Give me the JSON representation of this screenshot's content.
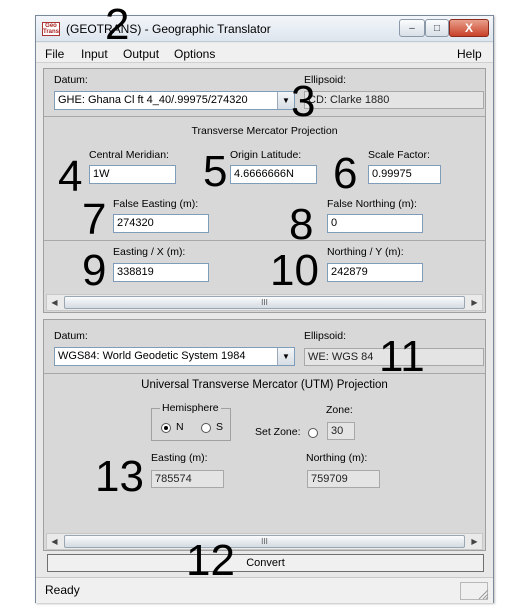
{
  "window": {
    "icon_text": "Geo Trans",
    "title": "(GEOTRANS) - Geographic Translator",
    "controls": {
      "minimize": "–",
      "maximize": "□",
      "close": "X"
    }
  },
  "menu": {
    "file": "File",
    "input": "Input",
    "output": "Output",
    "options": "Options",
    "help": "Help"
  },
  "input_panel": {
    "datum_label": "Datum:",
    "datum_value": "GHE:  Ghana Cl ft 4_40/.99975/274320",
    "ellipsoid_label": "Ellipsoid:",
    "ellipsoid_value": "CD: Clarke 1880",
    "projection_title": "Transverse Mercator Projection",
    "central_meridian_label": "Central Meridian:",
    "central_meridian_value": "1W",
    "origin_latitude_label": "Origin Latitude:",
    "origin_latitude_value": "4.6666666N",
    "scale_factor_label": "Scale Factor:",
    "scale_factor_value": "0.99975",
    "false_easting_label": "False Easting (m):",
    "false_easting_value": "274320",
    "false_northing_label": "False Northing (m):",
    "false_northing_value": "0",
    "easting_label": "Easting / X (m):",
    "easting_value": "338819",
    "northing_label": "Northing / Y (m):",
    "northing_value": "242879"
  },
  "output_panel": {
    "datum_label": "Datum:",
    "datum_value": "WGS84: World Geodetic System 1984",
    "ellipsoid_label": "Ellipsoid:",
    "ellipsoid_value": "WE: WGS 84",
    "projection_title": "Universal Transverse Mercator (UTM) Projection",
    "hemisphere_label": "Hemisphere",
    "hemisphere_n": "N",
    "hemisphere_s": "S",
    "zone_label": "Zone:",
    "set_zone_label": "Set Zone:",
    "zone_value": "30",
    "easting_label": "Easting (m):",
    "easting_value": "785574",
    "northing_label": "Northing (m):",
    "northing_value": "759709"
  },
  "scroll_thumb_glyph": "III",
  "convert_label": "Convert",
  "status_text": "Ready",
  "annotations": {
    "n2": "2",
    "n3": "3",
    "n4": "4",
    "n5": "5",
    "n6": "6",
    "n7": "7",
    "n8": "8",
    "n9": "9",
    "n10": "10",
    "n11": "11",
    "n12": "12",
    "n13": "13"
  },
  "colors": {
    "title_gradient_top": "#f3f6fa",
    "panel_bg": "#d8d8d8",
    "input_border": "#7f9db9",
    "close_button": "#c9402a"
  }
}
